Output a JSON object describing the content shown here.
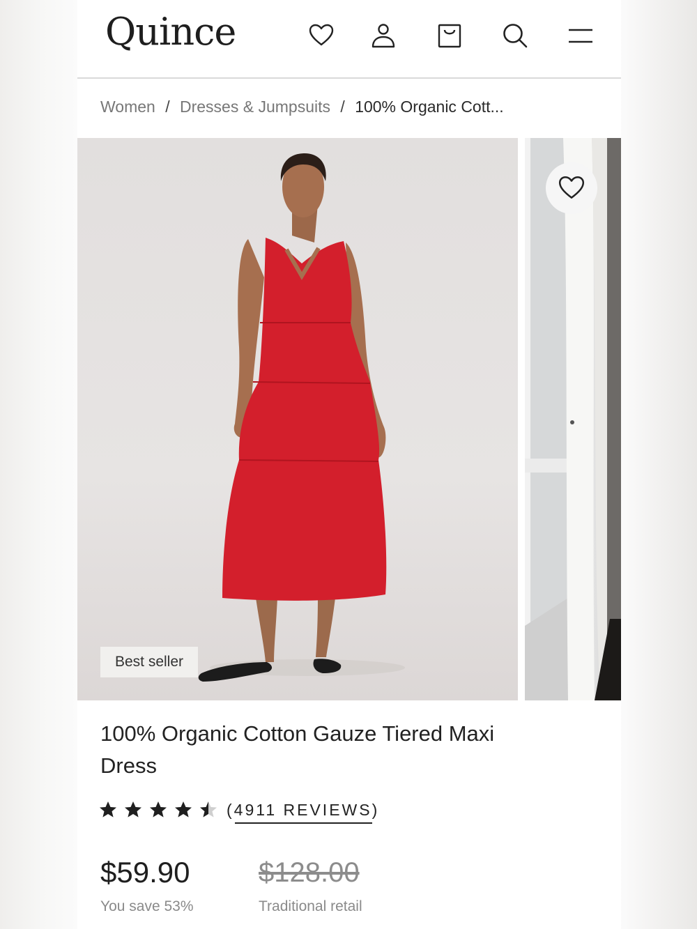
{
  "header": {
    "logo": "Quince",
    "icons": [
      "heart-icon",
      "account-icon",
      "cart-icon",
      "search-icon",
      "menu-icon"
    ]
  },
  "breadcrumb": {
    "items": [
      "Women",
      "Dresses & Jumpsuits"
    ],
    "current": "100% Organic Cott...",
    "separator": "/"
  },
  "gallery": {
    "badge": "Best seller",
    "icons": [
      "favorite-heart-icon"
    ]
  },
  "product": {
    "title": "100% Organic Cotton Gauze Tiered Maxi Dress",
    "rating": 4.5,
    "reviews_label": "(4911 REVIEWS)",
    "price": "$59.90",
    "savings": "You save 53%",
    "original_price": "$128.00",
    "original_price_label": "Traditional retail"
  },
  "colors": {
    "dress_red": "#d31f2c",
    "text_dark": "#222222",
    "text_muted": "#8a8a8a"
  }
}
